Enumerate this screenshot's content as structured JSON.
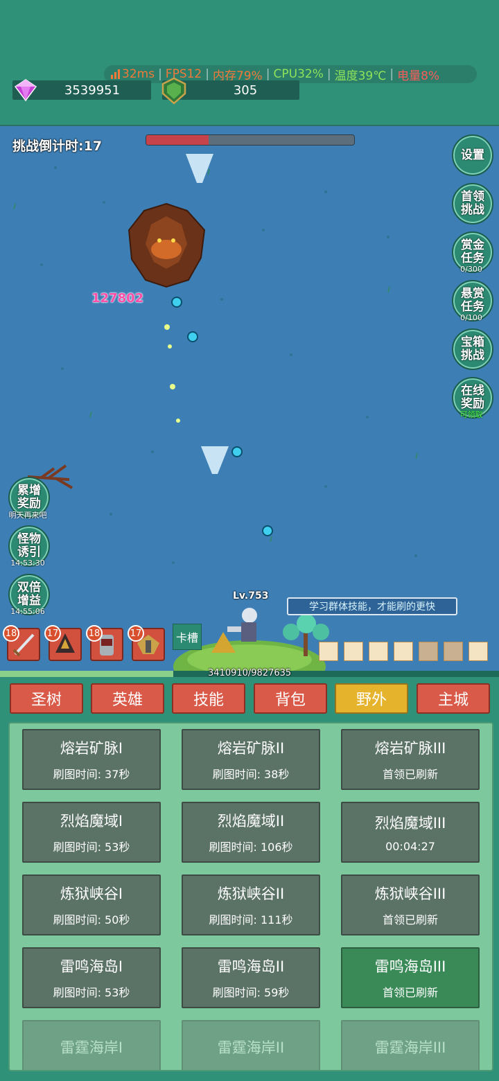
{
  "status": {
    "ping": "32ms",
    "fps": "FPS12",
    "memory": "内存79%",
    "cpu": "CPU32%",
    "temperature": "温度39℃",
    "battery": "电量8%"
  },
  "resources": {
    "gems": "3539951",
    "shields": "305"
  },
  "battle": {
    "countdown": "挑战倒计时:17",
    "boss_hp_fraction": 0.3,
    "damage_number": "127802",
    "hero_level": "Lv.753",
    "tip": "学习群体技能，才能刷的更快",
    "exp_text": "3410910/9827635",
    "exp_fraction": 0.347,
    "card_slot_label": "卡槽"
  },
  "right_menu": [
    {
      "label": [
        "设置"
      ],
      "sub": ""
    },
    {
      "label": [
        "首领",
        "挑战"
      ],
      "sub": ""
    },
    {
      "label": [
        "赏金",
        "任务"
      ],
      "sub": "0/300"
    },
    {
      "label": [
        "悬赏",
        "任务"
      ],
      "sub": "0/100"
    },
    {
      "label": [
        "宝箱",
        "挑战"
      ],
      "sub": ""
    },
    {
      "label": [
        "在线",
        "奖励"
      ],
      "sub": "可领取"
    }
  ],
  "left_menu": [
    {
      "label": [
        "累增",
        "奖励"
      ],
      "sub": "明天再来吧"
    },
    {
      "label": [
        "怪物",
        "诱引"
      ],
      "sub": "14:53:30"
    },
    {
      "label": [
        "双倍",
        "增益"
      ],
      "sub": "14:55:06"
    }
  ],
  "heroes": [
    {
      "level": "18",
      "icon": "sword-icon"
    },
    {
      "level": "17",
      "icon": "crow-warrior-icon"
    },
    {
      "level": "18",
      "icon": "armored-knight-icon"
    },
    {
      "level": "17",
      "icon": "winged-knight-icon"
    }
  ],
  "tabs": [
    "圣树",
    "英雄",
    "技能",
    "背包",
    "野外",
    "主城"
  ],
  "active_tab": "野外",
  "areas": [
    {
      "name": "熔岩矿脉I",
      "sub": "刷图时间: 37秒"
    },
    {
      "name": "熔岩矿脉II",
      "sub": "刷图时间: 38秒"
    },
    {
      "name": "熔岩矿脉III",
      "sub": "首领已刷新"
    },
    {
      "name": "烈焰魔域I",
      "sub": "刷图时间: 53秒"
    },
    {
      "name": "烈焰魔域II",
      "sub": "刷图时间: 106秒"
    },
    {
      "name": "烈焰魔域III",
      "sub": "00:04:27"
    },
    {
      "name": "炼狱峡谷I",
      "sub": "刷图时间: 50秒"
    },
    {
      "name": "炼狱峡谷II",
      "sub": "刷图时间: 111秒"
    },
    {
      "name": "炼狱峡谷III",
      "sub": "首领已刷新"
    },
    {
      "name": "雷鸣海岛I",
      "sub": "刷图时间: 53秒"
    },
    {
      "name": "雷鸣海岛II",
      "sub": "刷图时间: 59秒"
    },
    {
      "name": "雷鸣海岛III",
      "sub": "首领已刷新"
    },
    {
      "name": "雷霆海岸I",
      "sub": ""
    },
    {
      "name": "雷霆海岸II",
      "sub": ""
    },
    {
      "name": "雷霆海岸III",
      "sub": ""
    }
  ],
  "colors": {
    "background": "#2f9178",
    "field": "#3d7fb5",
    "tab": "#d95a48",
    "tab_active": "#e6b32c",
    "area": "#5b7267",
    "area_active": "#3a8a58"
  }
}
